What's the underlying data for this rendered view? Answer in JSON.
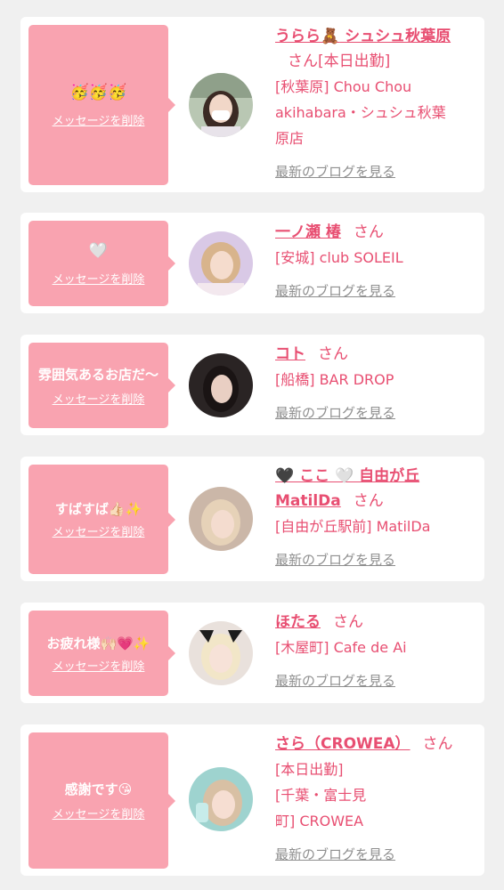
{
  "delete_label": "メッセージを削除",
  "blog_label": "最新のブログを見る",
  "san_label": "さん",
  "colors": {
    "accent": "#e84f72",
    "bubble": "#f9a3b0",
    "muted": "#8f8f8f",
    "bg": "#f0f0f0"
  },
  "cards": [
    {
      "message": "🥳🥳🥳",
      "name_parts": [
        "うらら",
        "🧸",
        " シュシュ秋葉原"
      ],
      "san_suffix": "[本日出勤]",
      "shop_lines": [
        "[秋葉原] Chou Chou",
        "akihabara・シュシュ秋葉",
        "原店"
      ]
    },
    {
      "message": "🤍",
      "name_parts": [
        "一ノ瀬 椿"
      ],
      "san_suffix": "",
      "shop_lines": [
        "[安城] club SOLEIL"
      ]
    },
    {
      "message": "雰囲気あるお店だ〜",
      "name_parts": [
        "コト"
      ],
      "san_suffix": "",
      "shop_lines": [
        "[船橋] BAR DROP"
      ]
    },
    {
      "message": "すばすば👍🏻✨",
      "name_parts": [
        "🖤 ここ 🤍 自由が丘 MatilDa"
      ],
      "san_suffix": "",
      "shop_lines": [
        "[自由が丘駅前] MatilDa"
      ]
    },
    {
      "message": "お疲れ様🙌🏻💗✨",
      "name_parts": [
        "ほたる"
      ],
      "san_suffix": "",
      "shop_lines": [
        "[木屋町] Cafe de Ai"
      ]
    },
    {
      "message": "感謝です😘",
      "name_parts": [
        "さら（CROWEA）"
      ],
      "san_suffix": "",
      "shop_lines": [
        "[本日出勤]",
        "[千葉・富士見",
        "町] CROWEA"
      ]
    }
  ]
}
